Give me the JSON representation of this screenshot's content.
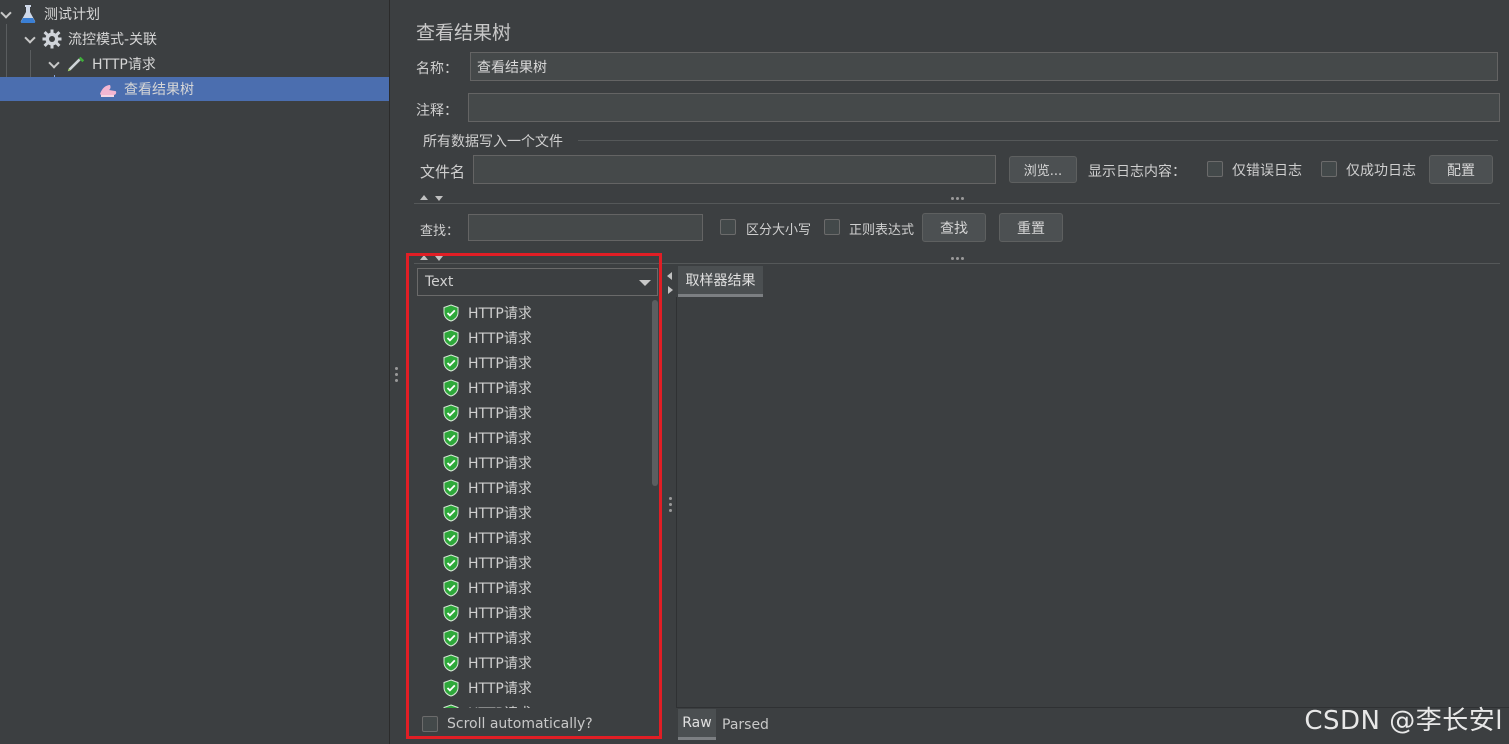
{
  "tree": {
    "items": [
      {
        "label": "测试计划",
        "icon": "flask-icon"
      },
      {
        "label": "流控模式-关联",
        "icon": "gear-icon"
      },
      {
        "label": "HTTP请求",
        "icon": "pipette-icon"
      },
      {
        "label": "查看结果树",
        "icon": "listener-icon"
      }
    ]
  },
  "form": {
    "title": "查看结果树",
    "name_label": "名称：",
    "name_value": "查看结果树",
    "comment_label": "注释：",
    "comment_value": "",
    "file_group_label": "所有数据写入一个文件",
    "filename_label": "文件名",
    "filename_value": "",
    "browse_button": "浏览...",
    "log_display_label": "显示日志内容：",
    "errors_only_label": "仅错误日志",
    "success_only_label": "仅成功日志",
    "configure_button": "配置"
  },
  "search": {
    "label": "查找：",
    "value": "",
    "case_label": "区分大小写",
    "regex_label": "正则表达式",
    "find_button": "查找",
    "reset_button": "重置"
  },
  "results": {
    "renderer": "Text",
    "items": [
      "HTTP请求",
      "HTTP请求",
      "HTTP请求",
      "HTTP请求",
      "HTTP请求",
      "HTTP请求",
      "HTTP请求",
      "HTTP请求",
      "HTTP请求",
      "HTTP请求",
      "HTTP请求",
      "HTTP请求",
      "HTTP请求",
      "HTTP请求",
      "HTTP请求",
      "HTTP请求",
      "HTTP请求"
    ],
    "scroll_auto_label": "Scroll automatically?",
    "sampler_tab": "取样器结果",
    "raw_tab": "Raw",
    "parsed_tab": "Parsed",
    "status_color": "#2ea83a"
  },
  "watermark": "CSDN @李长安l",
  "colors": {
    "selection": "#4b6eaf",
    "highlight_border": "#e11e25"
  }
}
